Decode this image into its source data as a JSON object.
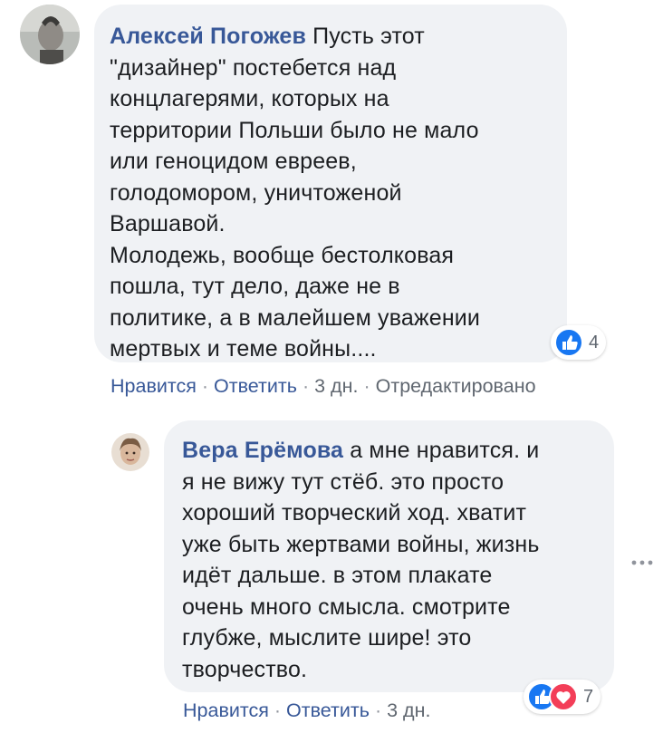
{
  "comments": [
    {
      "author": "Алексей Погожев",
      "lines": [
        "Пусть этот",
        "\"дизайнер\" постебется над",
        "концлагерями, которых на",
        "территории Польши было не мало",
        "или геноцидом евреев,",
        "голодомором, уничтоженой",
        "Варшавой.",
        "Молодежь, вообще бестолковая",
        "пошла, тут дело, даже не в",
        "политике, а в малейшем уважении",
        "мертвых и теме войны...."
      ],
      "reactions": {
        "icons": [
          "like-icon"
        ],
        "count": "4"
      },
      "actions": {
        "like": "Нравится",
        "reply": "Ответить",
        "time": "3 дн.",
        "edited": "Отредактировано"
      }
    },
    {
      "author": "Вера Ерёмова",
      "lines": [
        "а мне нравится. и",
        "я не вижу тут стёб. это просто",
        "хороший творческий ход. хватит",
        "уже быть жертвами войны, жизнь",
        "идёт дальше. в этом плакате",
        "очень много смысла. смотрите",
        "глубже, мыслите шире! это",
        "творчество."
      ],
      "reactions": {
        "icons": [
          "like-icon",
          "love-icon"
        ],
        "count": "7"
      },
      "actions": {
        "like": "Нравится",
        "reply": "Ответить",
        "time": "3 дн."
      }
    }
  ],
  "colors": {
    "link": "#385898",
    "bubble": "#f0f2f5",
    "like": "#1877f2",
    "love": "#f33e58"
  }
}
